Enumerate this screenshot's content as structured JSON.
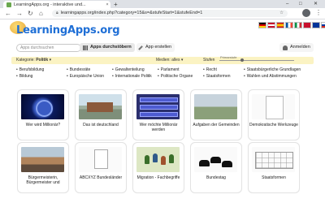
{
  "browser": {
    "tab_title": "LearningApps.org - interaktive und...",
    "new_tab": "+",
    "url": "learningapps.org/index.php?category=15&s=&stufeStart=1&stufeEnd=1",
    "window_controls": [
      "–",
      "□",
      "✕"
    ]
  },
  "header": {
    "logo": "LearningApps.org",
    "flag_colors": [
      "#c8102e",
      "#000000",
      "#f1bf00",
      "#0055a4",
      "#009246",
      "#c8102e",
      "#003399"
    ]
  },
  "toolbar": {
    "search_placeholder": "Apps durchsuchen",
    "browse_label": "Apps durchstöbern",
    "create_label": "App erstellen",
    "login_label": "Anmelden"
  },
  "filter": {
    "category_prefix": "Kategorie:",
    "category_value": "Politik",
    "media_label": "Medien: alles",
    "levels_label": "Stufen",
    "slider_label": "Primarstufe"
  },
  "categories": {
    "col1": [
      "Berufsbildung",
      "Bildung"
    ],
    "col2": [
      "Bundesräte",
      "Europäische Union"
    ],
    "col3": [
      "Gewaltenteilung",
      "Internationale Politik"
    ],
    "col4": [
      "Parlament",
      "Politische Organe"
    ],
    "col5": [
      "Recht",
      "Staatsformen"
    ],
    "col6": [
      "Staatsbürgerliche Grundlagen",
      "Wahlen und Abstimmungen"
    ]
  },
  "apps": [
    {
      "title": "Wer wird Millionär?"
    },
    {
      "title": "Das ist deutschland"
    },
    {
      "title": "Wer möchte Millionär werden"
    },
    {
      "title": "Aufgaben der Gemeinden"
    },
    {
      "title": "Demokratische Werkzeuge"
    },
    {
      "title": "Bürgermeisterin, Bürgermeister und"
    },
    {
      "title": "ABCXYZ Bundesländer"
    },
    {
      "title": "Migration - Fachbegriffe"
    },
    {
      "title": "Bundestag"
    },
    {
      "title": "Staatsformen"
    }
  ],
  "colors": {
    "brand_blue": "#1f6fd6",
    "filter_bg": "#fbf3c3"
  }
}
